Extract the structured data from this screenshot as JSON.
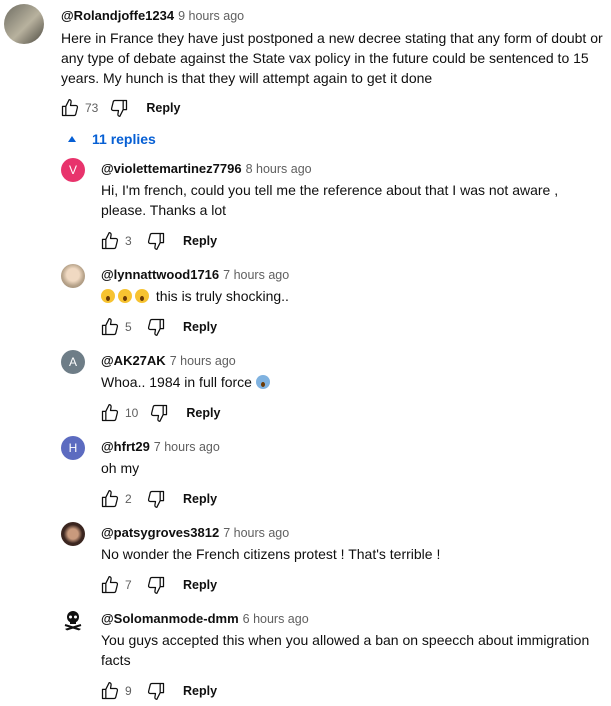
{
  "top_comment": {
    "handle": "@Rolandjoffe1234",
    "time": "9 hours ago",
    "text": "Here in France they have just postponed a new decree stating that any form of doubt or any type of debate against the State vax policy in the future could be  sentenced to 15 years. My hunch is that they will attempt again to get it done",
    "likes": "73",
    "reply_label": "Reply"
  },
  "replies_toggle": {
    "label": "11 replies"
  },
  "replies": [
    {
      "handle": "@violettemartinez7796",
      "time": "8 hours ago",
      "text": "Hi, I'm french, could you tell me the reference about that I was not aware , please. Thanks a lot",
      "likes": "3",
      "reply_label": "Reply",
      "avatar_letter": "V",
      "avatar_color": "#e8336c"
    },
    {
      "handle": "@lynnattwood1716",
      "time": "7 hours ago",
      "text": "this is truly shocking..",
      "likes": "5",
      "reply_label": "Reply",
      "avatar_letter": "",
      "avatar_color": "#c9b9a5"
    },
    {
      "handle": "@AK27AK",
      "time": "7 hours ago",
      "text": "Whoa.. 1984 in full force",
      "likes": "10",
      "reply_label": "Reply",
      "avatar_letter": "A",
      "avatar_color": "#6e7d87"
    },
    {
      "handle": "@hfrt29",
      "time": "7 hours ago",
      "text": "oh my",
      "likes": "2",
      "reply_label": "Reply",
      "avatar_letter": "H",
      "avatar_color": "#5c6bc0"
    },
    {
      "handle": "@patsygroves3812",
      "time": "7 hours ago",
      "text": "No wonder the French citizens protest ! That's terrible !",
      "likes": "7",
      "reply_label": "Reply",
      "avatar_letter": "",
      "avatar_color": "#5a3a2e"
    },
    {
      "handle": "@Solomanmode-dmm",
      "time": "6 hours ago",
      "text": "You guys accepted this when you allowed a ban on speecch about immigration facts",
      "likes": "9",
      "reply_label": "Reply",
      "avatar_letter": "",
      "avatar_color": "#ffffff"
    }
  ],
  "icons": {
    "like": "thumbs-up-icon",
    "dislike": "thumbs-down-icon",
    "expand": "triangle-up-icon"
  }
}
